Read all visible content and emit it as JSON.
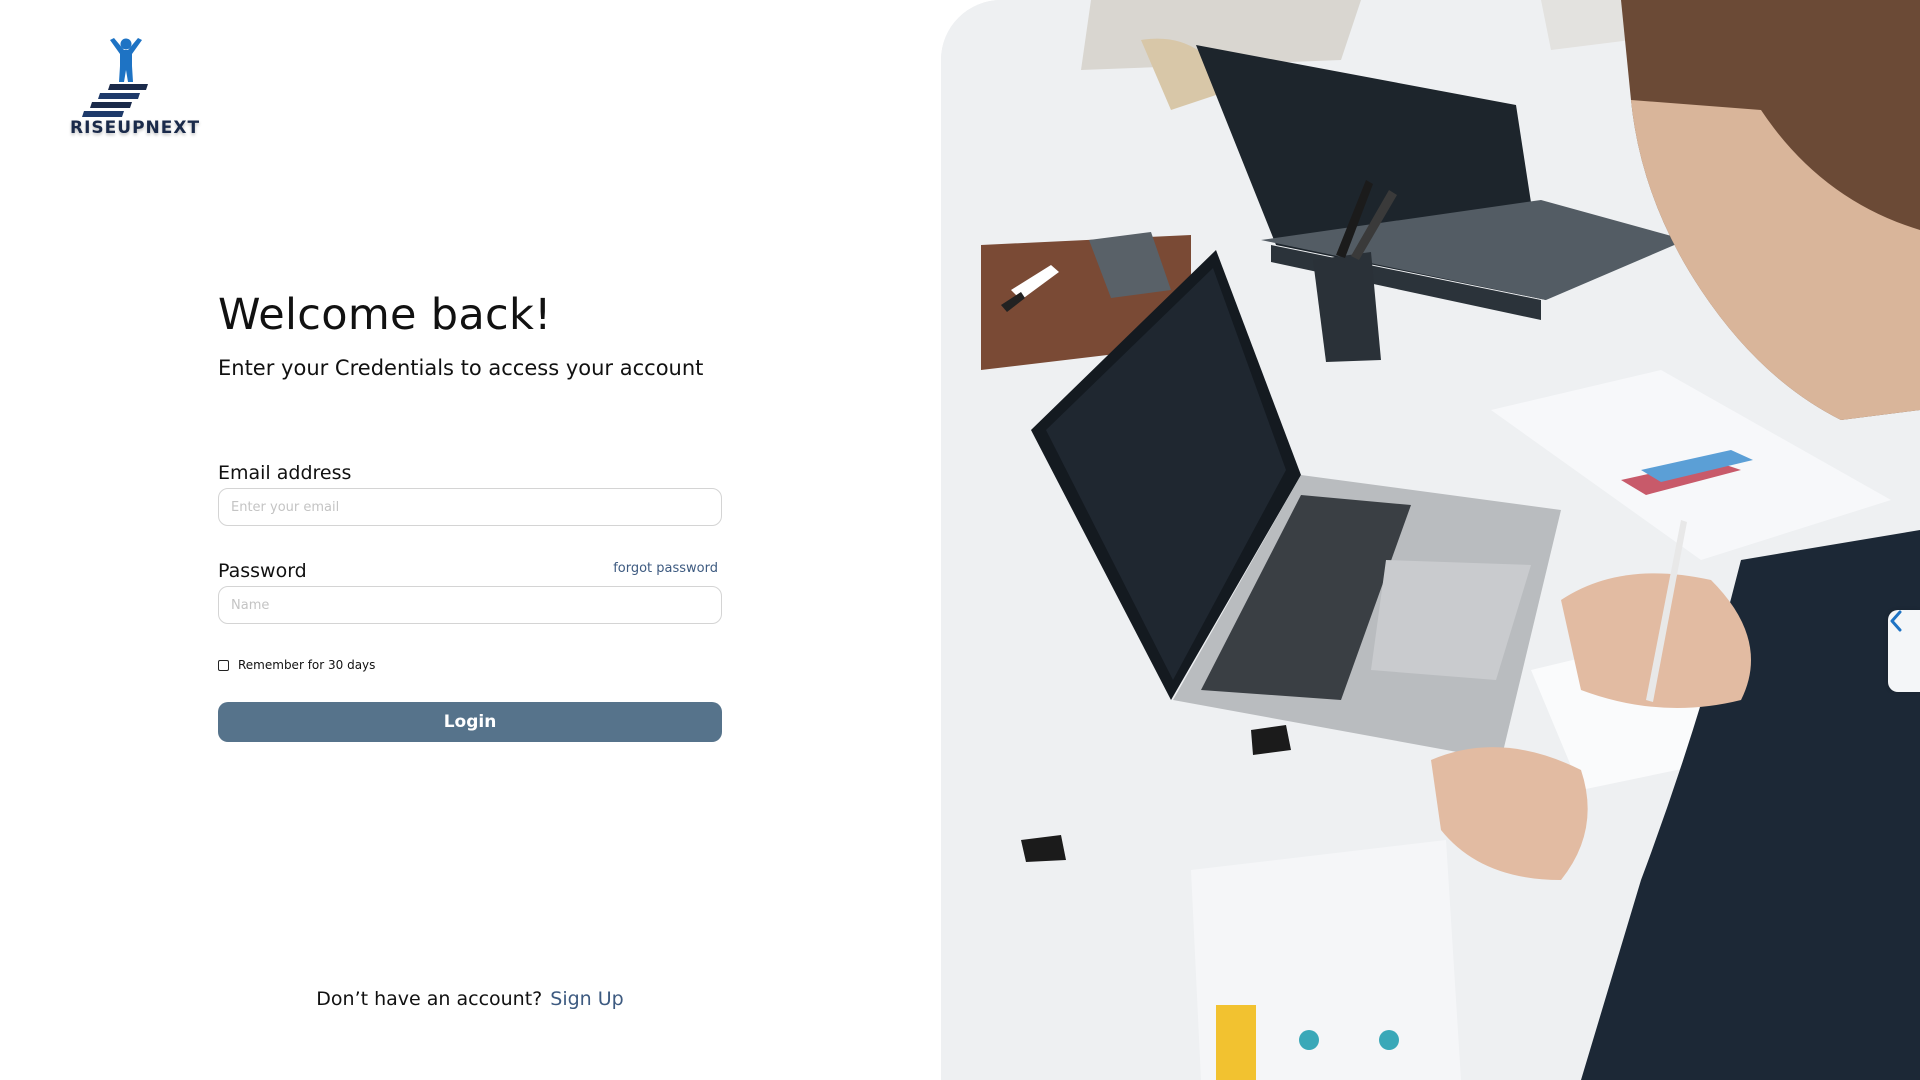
{
  "brand": {
    "name": "RISEUPNEXT"
  },
  "heading": {
    "title": "Welcome back!",
    "subtitle": "Enter your Credentials to access your account"
  },
  "form": {
    "email_label": "Email address",
    "email_placeholder": "Enter your email",
    "email_value": "",
    "password_label": "Password",
    "password_placeholder": "Name",
    "password_value": "",
    "forgot_label": "forgot password",
    "remember_label": "Remember for 30 days",
    "remember_checked": false,
    "login_label": "Login"
  },
  "footer": {
    "prompt": "Don’t have an account?",
    "signup_label": "Sign Up"
  },
  "photo_panel": {
    "collapse_icon": "chevron-left-icon"
  },
  "colors": {
    "accent": "#56738b",
    "link": "#3d5a80",
    "brand_blue": "#1e73c4",
    "brand_navy": "#1a2a4a"
  }
}
